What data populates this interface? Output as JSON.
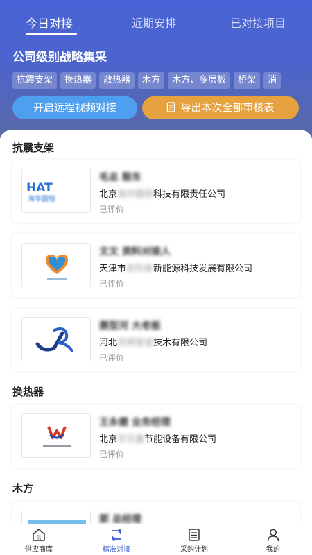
{
  "tabs": [
    {
      "label": "今日对接"
    },
    {
      "label": "近期安排"
    },
    {
      "label": "已对接项目"
    }
  ],
  "section_title": "公司级别战略集采",
  "chips": [
    "抗震支架",
    "换热器",
    "散热器",
    "木方",
    "木方、多层板",
    "桥架",
    "消"
  ],
  "buttons": {
    "video": "开启远程视频对接",
    "export": "导出本次全部审核表"
  },
  "groups": [
    {
      "title": "抗震支架",
      "cards": [
        {
          "contact": "毛总  殷东",
          "company_prefix": "北京",
          "company_blur": "海华圆恒",
          "company_suffix": "科技有限责任公司",
          "status": "已评价",
          "logo": "hat-icon",
          "logo_text": "HAT",
          "logo_sub": "海华圆恒"
        },
        {
          "contact": "文文  资料对接人",
          "company_prefix": "天津市",
          "company_blur": "安利来",
          "company_suffix": "新能源科技发展有限公司",
          "status": "已评价",
          "logo": "heart-logo-icon"
        },
        {
          "contact": "聂型河  大老板",
          "company_prefix": "河北",
          "company_blur": "京辉管道",
          "company_suffix": "技术有限公司",
          "status": "已评价",
          "logo": "jr-logo-icon"
        }
      ]
    },
    {
      "title": "换热器",
      "cards": [
        {
          "contact": "王永健  业务经理",
          "company_prefix": "北京",
          "company_blur": "华艾鑫",
          "company_suffix": "节能设备有限公司",
          "status": "已评价",
          "logo": "w-logo-icon"
        }
      ]
    },
    {
      "title": "木方",
      "cards": [
        {
          "contact": "郭  总经理",
          "logo": "blue-logo-icon"
        }
      ]
    }
  ],
  "bottom_nav": [
    {
      "label": "供应商库",
      "icon": "supplier-home-icon",
      "icon_char": "供"
    },
    {
      "label": "精准对接",
      "icon": "sync-icon"
    },
    {
      "label": "采购计划",
      "icon": "list-icon"
    },
    {
      "label": "我的",
      "icon": "person-icon"
    }
  ],
  "colors": {
    "header_top": "#4a63d6",
    "header_bottom": "#5a6aa6",
    "video_button": "#4f9ff0",
    "export_button": "#e5a23f",
    "active_nav": "#3f5bd0"
  }
}
